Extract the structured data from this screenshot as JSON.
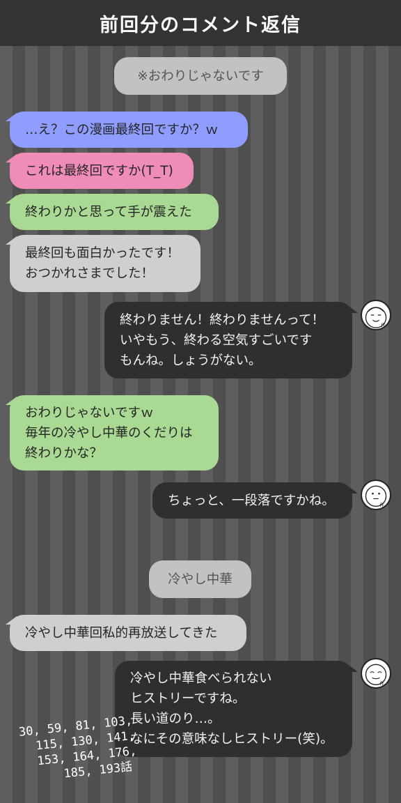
{
  "header": {
    "title": "前回分のコメント返信"
  },
  "messages": {
    "m1": {
      "lines": [
        "※おわりじゃないです"
      ]
    },
    "m2": {
      "lines": [
        "…え？この漫画最終回ですか？ｗ"
      ]
    },
    "m3": {
      "lines": [
        "これは最終回ですか(T_T)"
      ]
    },
    "m4": {
      "lines": [
        "終わりかと思って手が震えた"
      ]
    },
    "m5": {
      "lines": [
        "最終回も面白かったです！",
        "おつかれさまでした！"
      ]
    },
    "m6": {
      "lines": [
        "終わりません！終わりませんって！",
        "いやもう、終わる空気すごいです",
        "もんね。しょうがない。"
      ]
    },
    "m7": {
      "lines": [
        "おわりじゃないですｗ",
        "毎年の冷やし中華のくだりは",
        "終わりかな？"
      ]
    },
    "m8": {
      "lines": [
        "ちょっと、一段落ですかね。"
      ]
    },
    "m9": {
      "lines": [
        "冷やし中華"
      ]
    },
    "m10": {
      "lines": [
        "冷やし中華回私的再放送してきた"
      ]
    },
    "m11": {
      "lines": [
        "冷やし中華食べられない",
        "ヒストリーですね。",
        "長い道のり…。",
        "なにその意味なしヒストリー(笑)。"
      ]
    }
  },
  "avatars": {
    "label": "作"
  },
  "note": {
    "lines": [
      "30, 59, 81, 103,",
      "115, 130, 141,",
      "153, 164, 176,",
      "185, 193話"
    ]
  },
  "colors": {
    "header_bg": "#333333",
    "reader_blue": "#8f9dff",
    "reader_pink": "#f08cb8",
    "reader_green": "#a9d993",
    "reader_gray": "#cfcfcf",
    "author_dark": "#2f2f2f"
  }
}
